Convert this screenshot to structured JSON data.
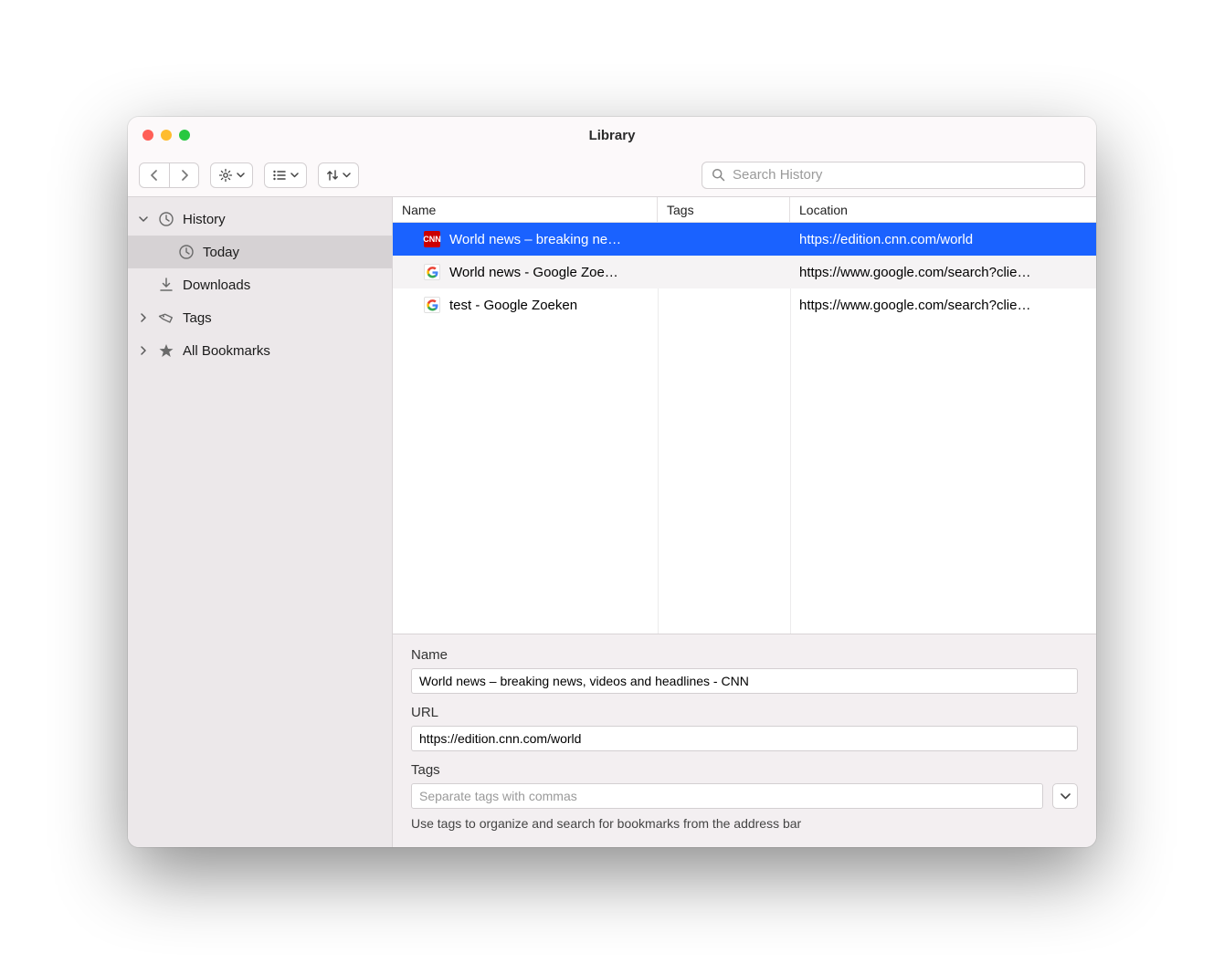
{
  "window": {
    "title": "Library"
  },
  "toolbar": {
    "search_placeholder": "Search History"
  },
  "sidebar": {
    "history_label": "History",
    "today_label": "Today",
    "downloads_label": "Downloads",
    "tags_label": "Tags",
    "bookmarks_label": "All Bookmarks"
  },
  "columns": {
    "name": "Name",
    "tags": "Tags",
    "location": "Location"
  },
  "rows": [
    {
      "name": "World news – breaking ne…",
      "location": "https://edition.cnn.com/world",
      "favicon": "cnn",
      "selected": true
    },
    {
      "name": "World news - Google Zoe…",
      "location": "https://www.google.com/search?clie…",
      "favicon": "google",
      "alt": true
    },
    {
      "name": "test - Google Zoeken",
      "location": "https://www.google.com/search?clie…",
      "favicon": "google"
    }
  ],
  "details": {
    "name_label": "Name",
    "name_value": "World news – breaking news, videos and headlines - CNN",
    "url_label": "URL",
    "url_value": "https://edition.cnn.com/world",
    "tags_label": "Tags",
    "tags_placeholder": "Separate tags with commas",
    "hint": "Use tags to organize and search for bookmarks from the address bar"
  }
}
